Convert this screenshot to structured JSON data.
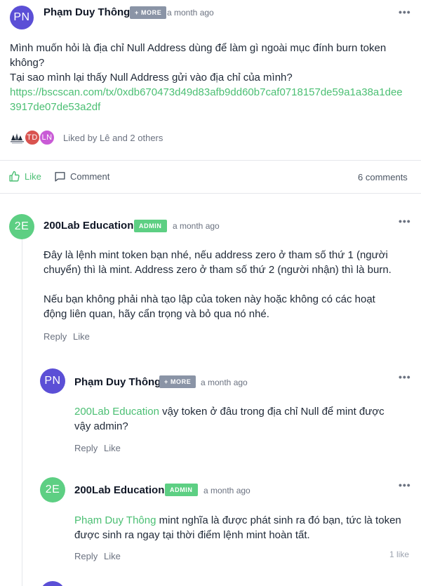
{
  "post": {
    "author_initials": "PN",
    "author_name": "Phạm Duy Thông",
    "badge": "+ MORE",
    "time": "a month ago",
    "more_menu": "•••",
    "text_line1": "Mình muốn hỏi là địa chỉ Null Address dùng để làm gì ngoài mục đính burn token không?",
    "text_line2": "Tại sao mình lại thấy Null Address gửi vào địa chỉ của mình?",
    "link": "https://bscscan.com/tx/0xdb670473d49d83afb9dd60b7caf0718157de59a1a38a1dee3917de07de53a2df",
    "likers": [
      "TD",
      "LN"
    ],
    "liked_by": "Liked by Lê and 2 others",
    "like_label": "Like",
    "comment_label": "Comment",
    "comments_count": "6 comments"
  },
  "comments": [
    {
      "initials": "2E",
      "name": "200Lab Education",
      "badge": "ADMIN",
      "time": "a month ago",
      "more_menu": "•••",
      "para1": "Đây là lệnh mint token bạn nhé, nếu address zero ở tham số thứ 1 (người chuyển) thì là mint. Address zero ở tham số thứ 2 (người nhận) thì là burn.",
      "para2": "Nếu bạn không phải nhà tạo lập của token này hoặc không có các hoạt động liên quan, hãy cẩn trọng và bỏ qua nó nhé.",
      "reply_label": "Reply",
      "like_label": "Like"
    },
    {
      "initials": "PN",
      "name": "Phạm Duy Thông",
      "badge": "+ MORE",
      "time": "a month ago",
      "more_menu": "•••",
      "mention": "200Lab Education",
      "text": " vậy token ở đâu trong địa chỉ Null để mint được vậy admin?",
      "reply_label": "Reply",
      "like_label": "Like"
    },
    {
      "initials": "2E",
      "name": "200Lab Education",
      "badge": "ADMIN",
      "time": "a month ago",
      "more_menu": "•••",
      "mention": "Phạm Duy Thông",
      "text": " mint nghĩa là được phát sinh ra đó bạn, tức là token được sinh ra ngay tại thời điểm lệnh mint hoàn tất.",
      "reply_label": "Reply",
      "like_label": "Like",
      "like_count": "1 like"
    }
  ],
  "colors": {
    "purple_avatar": "#5b4fd6",
    "green_avatar": "#5dcf83",
    "td_avatar": "#d9534f",
    "ln_avatar": "#c95bd6",
    "more_badge": "#8a94a6",
    "admin_badge": "#5dcf83",
    "link": "#4bbf73"
  },
  "icons": [
    "like-thumb-icon",
    "comment-bubble-icon",
    "more-dots-icon",
    "tree-logo-icon"
  ]
}
